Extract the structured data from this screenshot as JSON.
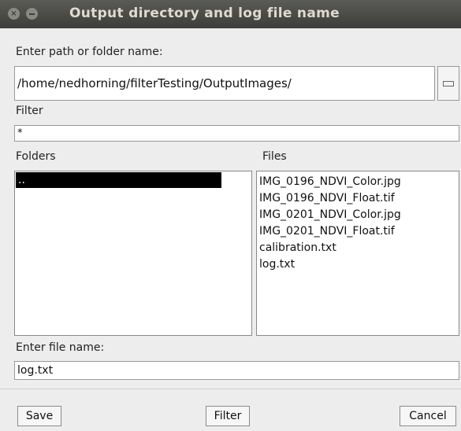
{
  "window": {
    "title": "Output directory and log file name",
    "close_glyph": "×"
  },
  "path": {
    "label": "Enter path or folder name:",
    "value": "/home/nedhorning/filterTesting/OutputImages/"
  },
  "filter": {
    "label": "Filter",
    "value": "*"
  },
  "folders": {
    "label": "Folders",
    "items": [
      ".."
    ]
  },
  "files": {
    "label": "Files",
    "items": [
      "IMG_0196_NDVI_Color.jpg",
      "IMG_0196_NDVI_Float.tif",
      "IMG_0201_NDVI_Color.jpg",
      "IMG_0201_NDVI_Float.tif",
      "calibration.txt",
      "log.txt"
    ]
  },
  "filename": {
    "label": "Enter file name:",
    "value": "log.txt"
  },
  "buttons": {
    "save": "Save",
    "filter": "Filter",
    "cancel": "Cancel"
  }
}
